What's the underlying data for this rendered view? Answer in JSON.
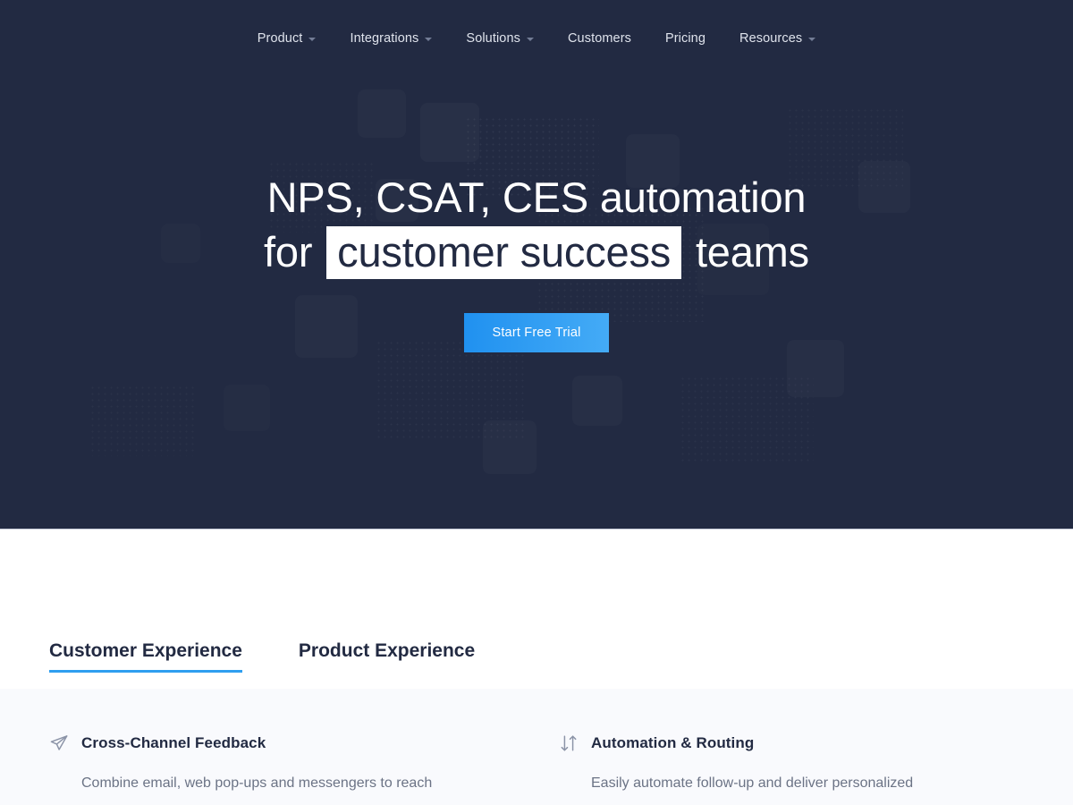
{
  "colors": {
    "hero_bg": "#222a42",
    "accent": "#2f9ff0",
    "cta_from": "#2091f0",
    "cta_to": "#44abf6",
    "features_bg": "#f9fafd",
    "nav_text": "#dfe3ec",
    "body_text": "#6b7385",
    "heading": "#222a42"
  },
  "nav": {
    "items": [
      {
        "label": "Product",
        "has_caret": true,
        "icon": "chevron-down-icon"
      },
      {
        "label": "Integrations",
        "has_caret": true,
        "icon": "chevron-down-icon"
      },
      {
        "label": "Solutions",
        "has_caret": true,
        "icon": "chevron-down-icon"
      },
      {
        "label": "Customers",
        "has_caret": false,
        "icon": ""
      },
      {
        "label": "Pricing",
        "has_caret": false,
        "icon": ""
      },
      {
        "label": "Resources",
        "has_caret": true,
        "icon": "chevron-down-icon"
      }
    ]
  },
  "hero": {
    "headline_line1": "NPS, CSAT, CES automation",
    "headline_line2_pre": "for",
    "headline_highlight": "customer success",
    "headline_line2_post": "teams",
    "cta_label": "Start Free Trial"
  },
  "tabs": [
    {
      "label": "Customer Experience",
      "active": true
    },
    {
      "label": "Product Experience",
      "active": false
    }
  ],
  "features": [
    {
      "icon": "send-icon",
      "title": "Cross-Channel Feedback",
      "description": "Combine email, web pop-ups and messengers to reach"
    },
    {
      "icon": "exchange-arrows-icon",
      "title": "Automation & Routing",
      "description": "Easily automate follow-up and deliver personalized"
    }
  ]
}
